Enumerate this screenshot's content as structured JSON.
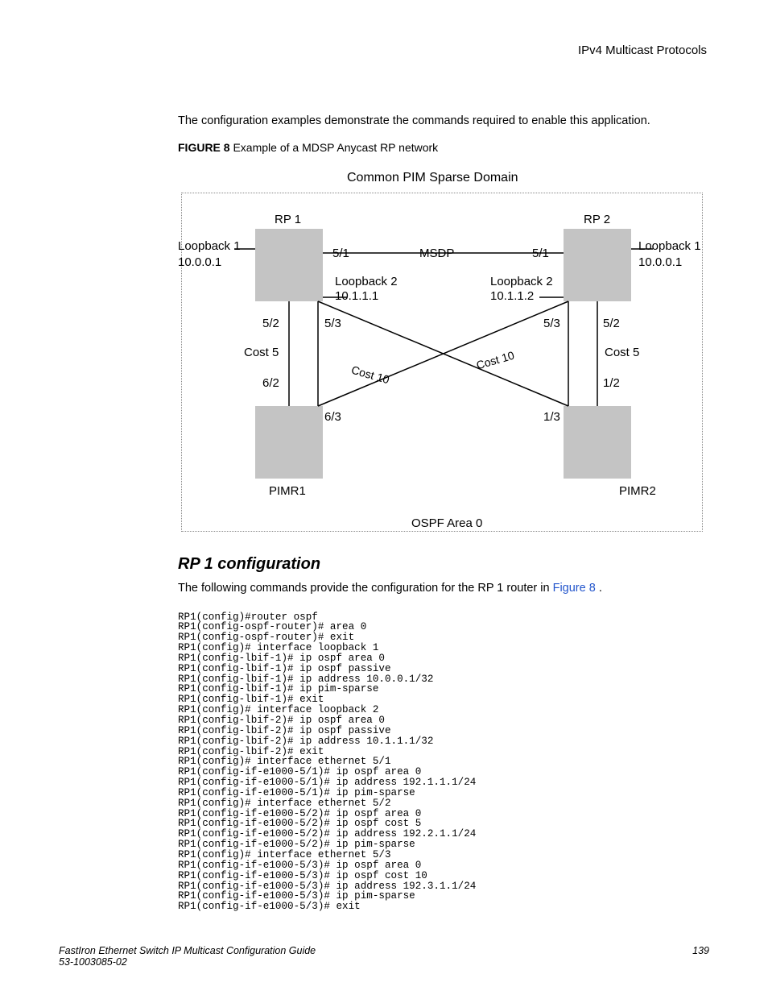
{
  "header": {
    "right": "IPv4 Multicast Protocols"
  },
  "intro": "The configuration examples demonstrate the commands required to enable this application.",
  "figure": {
    "label": "FIGURE 8",
    "caption": "Example of a MDSP Anycast RP network",
    "title": "Common PIM Sparse Domain",
    "ospf_area": "OSPF Area 0",
    "rp1": "RP 1",
    "rp2": "RP 2",
    "loop1a": "Loopback 1",
    "loop1a_ip": "10.0.0.1",
    "loop1b": "Loopback 1",
    "loop1b_ip": "10.0.0.1",
    "loop2a": "Loopback 2",
    "loop2a_ip": "10.1.1.1",
    "loop2b": "Loopback 2",
    "loop2b_ip": "10.1.1.2",
    "msdp": "MSDP",
    "p51a": "5/1",
    "p51b": "5/1",
    "p52a": "5/2",
    "p53a": "5/3",
    "p53b": "5/3",
    "p52b": "5/2",
    "p62": "6/2",
    "p63": "6/3",
    "p13": "1/3",
    "p12": "1/2",
    "cost5a": "Cost 5",
    "cost5b": "Cost 5",
    "cost10a": "Cost 10",
    "cost10b": "Cost 10",
    "pimr1": "PIMR1",
    "pimr2": "PIMR2"
  },
  "section": {
    "heading": "RP 1 configuration",
    "intro_pre": "The following commands provide the configuration for the RP 1 router in ",
    "intro_link": "Figure 8",
    "intro_post": " ."
  },
  "code": "RP1(config)#router ospf\nRP1(config-ospf-router)# area 0\nRP1(config-ospf-router)# exit\nRP1(config)# interface loopback 1\nRP1(config-lbif-1)# ip ospf area 0\nRP1(config-lbif-1)# ip ospf passive\nRP1(config-lbif-1)# ip address 10.0.0.1/32\nRP1(config-lbif-1)# ip pim-sparse\nRP1(config-lbif-1)# exit\nRP1(config)# interface loopback 2\nRP1(config-lbif-2)# ip ospf area 0\nRP1(config-lbif-2)# ip ospf passive\nRP1(config-lbif-2)# ip address 10.1.1.1/32\nRP1(config-lbif-2)# exit\nRP1(config)# interface ethernet 5/1\nRP1(config-if-e1000-5/1)# ip ospf area 0\nRP1(config-if-e1000-5/1)# ip address 192.1.1.1/24\nRP1(config-if-e1000-5/1)# ip pim-sparse\nRP1(config)# interface ethernet 5/2\nRP1(config-if-e1000-5/2)# ip ospf area 0\nRP1(config-if-e1000-5/2)# ip ospf cost 5\nRP1(config-if-e1000-5/2)# ip address 192.2.1.1/24\nRP1(config-if-e1000-5/2)# ip pim-sparse\nRP1(config)# interface ethernet 5/3\nRP1(config-if-e1000-5/3)# ip ospf area 0\nRP1(config-if-e1000-5/3)# ip ospf cost 10\nRP1(config-if-e1000-5/3)# ip address 192.3.1.1/24\nRP1(config-if-e1000-5/3)# ip pim-sparse\nRP1(config-if-e1000-5/3)# exit",
  "footer": {
    "title": "FastIron Ethernet Switch IP Multicast Configuration Guide",
    "docnum": "53-1003085-02",
    "page": "139"
  }
}
